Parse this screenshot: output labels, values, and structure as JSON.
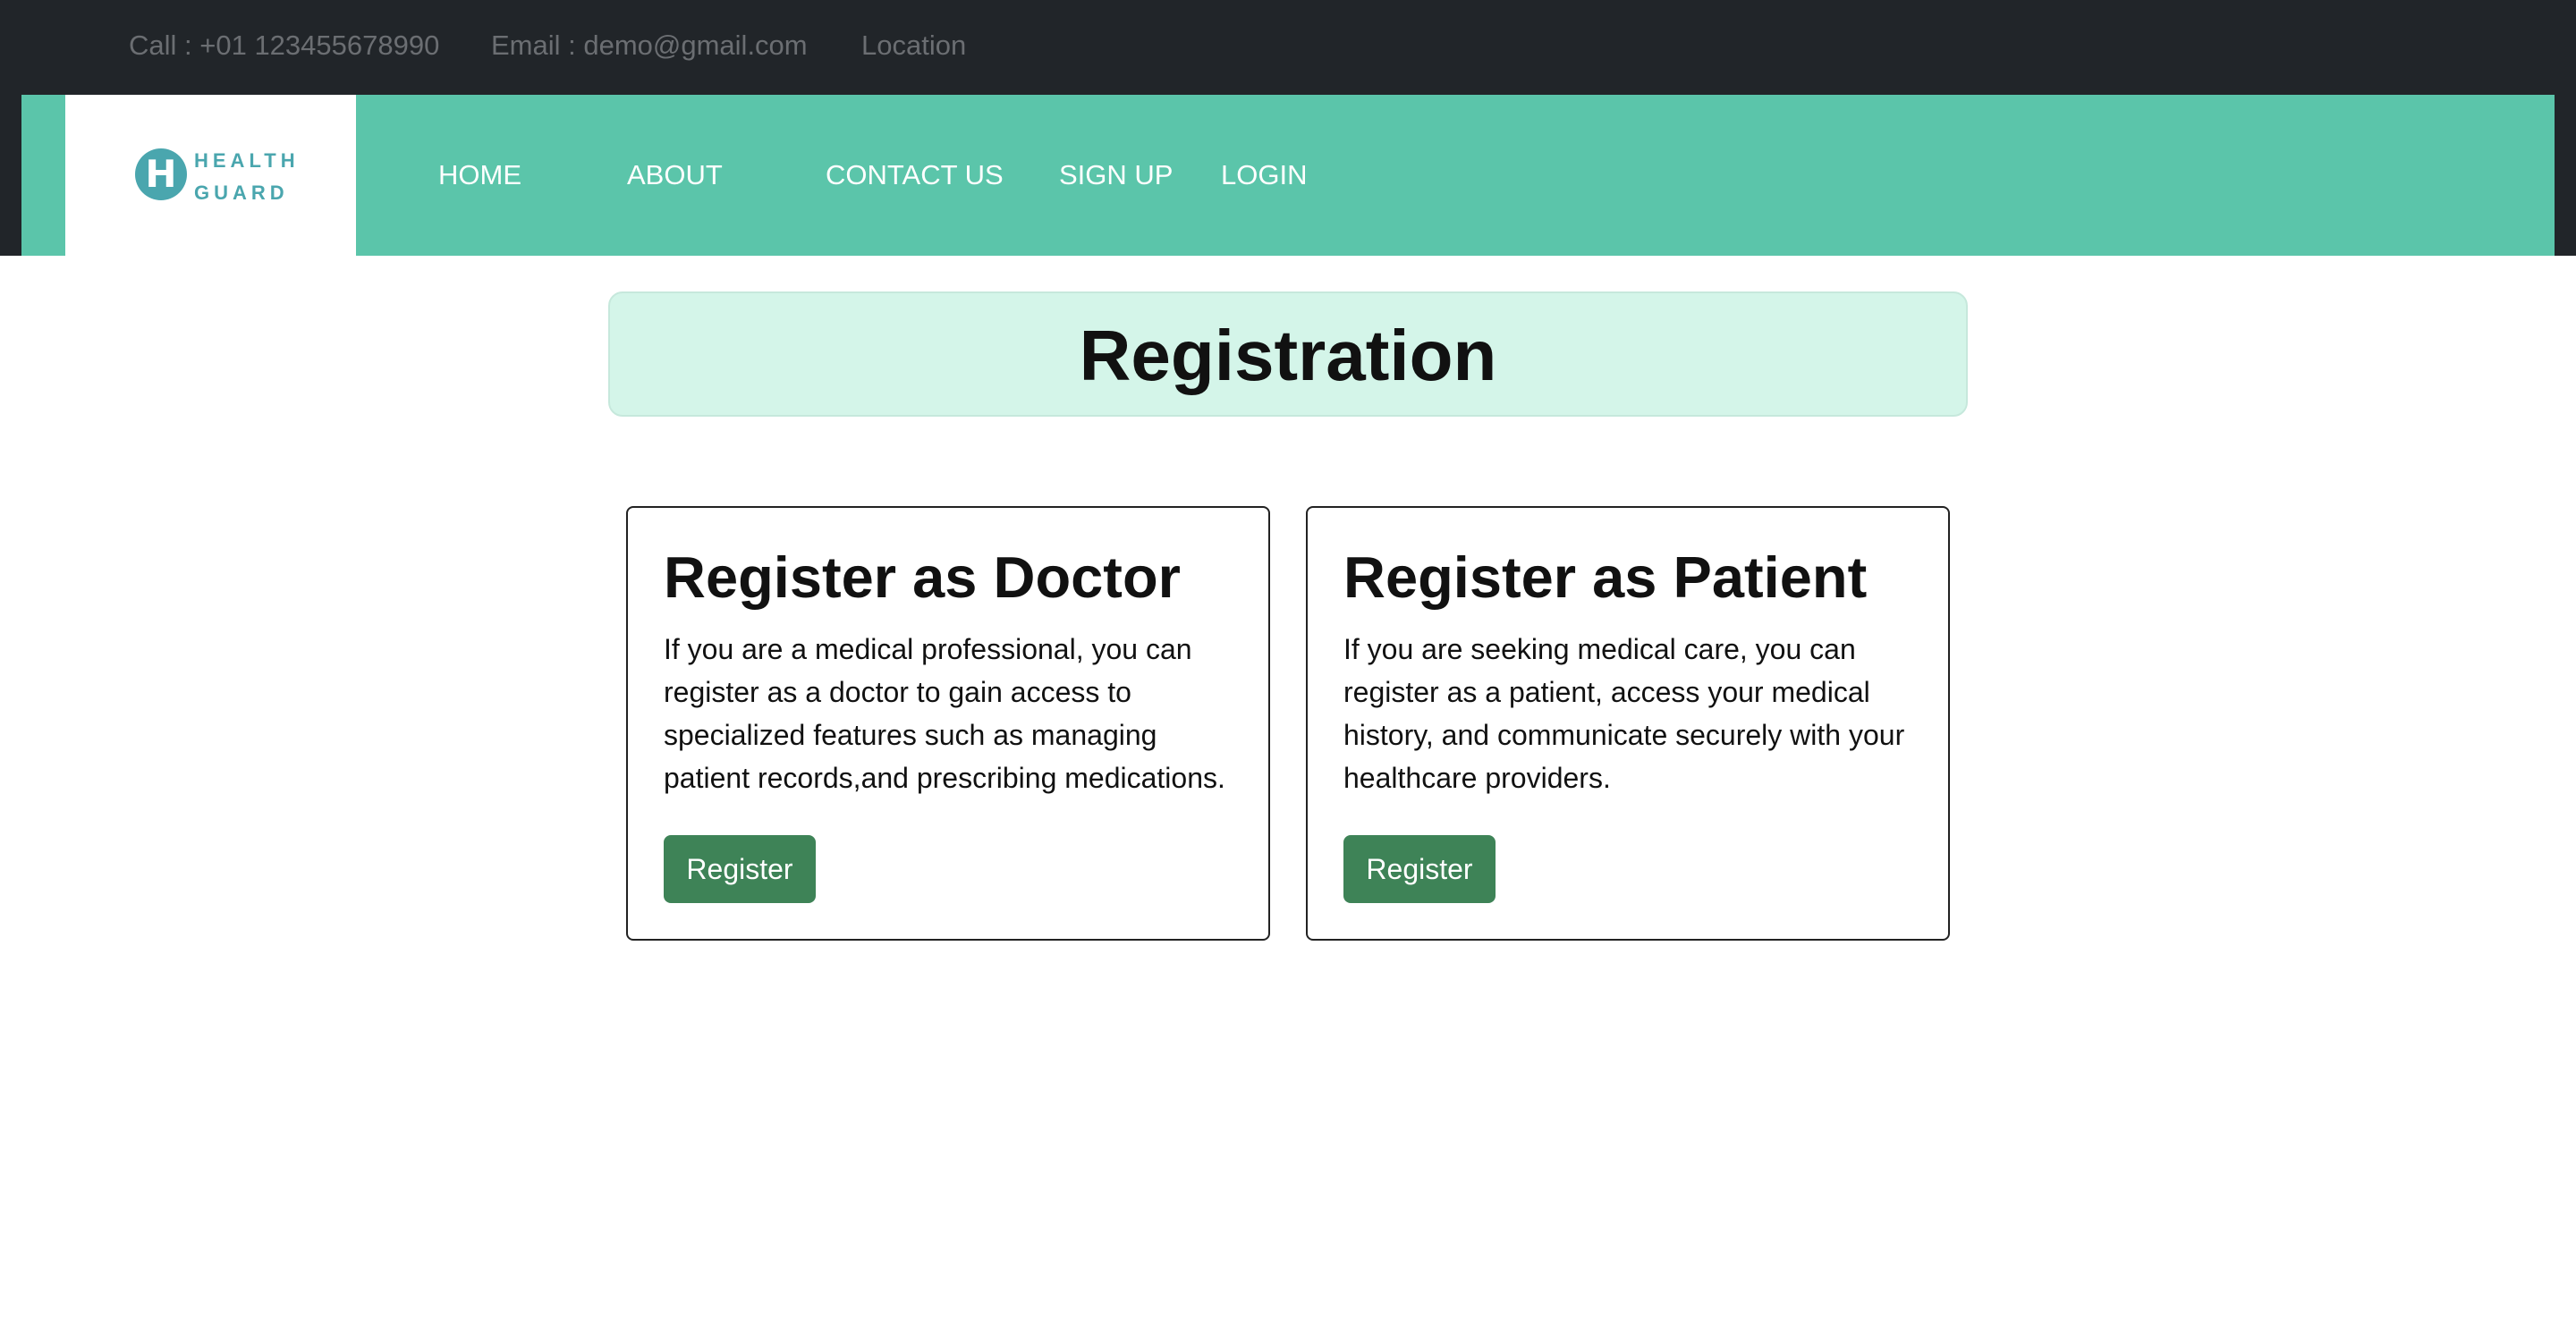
{
  "topbar": {
    "call": "Call : +01 123455678990",
    "email": "Email : demo@gmail.com",
    "location": "Location"
  },
  "logo": {
    "letter": "H",
    "line1": "HEALTH",
    "line2": "GUARD",
    "color": "#4aa6ae"
  },
  "nav": {
    "items": [
      {
        "label": "HOME"
      },
      {
        "label": "ABOUT"
      },
      {
        "label": "CONTACT US"
      },
      {
        "label": "SIGN UP"
      },
      {
        "label": "LOGIN"
      }
    ],
    "background": "#5bc5aa"
  },
  "page": {
    "title": "Registration"
  },
  "cards": [
    {
      "title": "Register as Doctor",
      "description": "If you are a medical professional, you can register as a doctor to gain access to specialized features such as managing patient records,and prescribing medications.",
      "button_label": "Register"
    },
    {
      "title": "Register as Patient",
      "description": "If you are seeking medical care, you can register as a patient, access your medical history, and communicate securely with your healthcare providers.",
      "button_label": "Register"
    }
  ],
  "colors": {
    "topbar": "#212529",
    "accent": "#5bc5aa",
    "button": "#3e8357",
    "header_bg": "#d4f5e9"
  }
}
